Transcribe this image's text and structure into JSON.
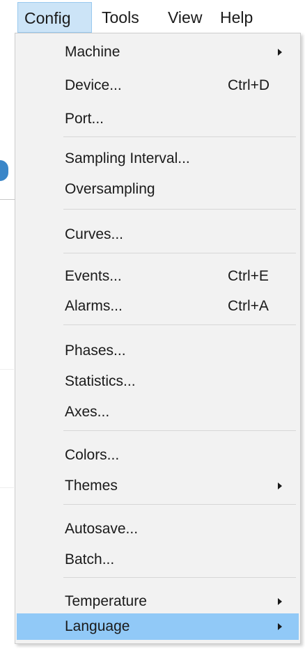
{
  "menubar": {
    "items": [
      {
        "label": "Config",
        "active": true
      },
      {
        "label": "Tools",
        "active": false
      },
      {
        "label": "View",
        "active": false
      },
      {
        "label": "Help",
        "active": false
      }
    ]
  },
  "menu": {
    "items": [
      {
        "label": "Machine",
        "shortcut": "",
        "submenu": true
      },
      {
        "label": "Device...",
        "shortcut": "Ctrl+D",
        "submenu": false
      },
      {
        "label": "Port...",
        "shortcut": "",
        "submenu": false
      },
      {
        "label": "Sampling Interval...",
        "shortcut": "",
        "submenu": false
      },
      {
        "label": "Oversampling",
        "shortcut": "",
        "submenu": false
      },
      {
        "label": "Curves...",
        "shortcut": "",
        "submenu": false
      },
      {
        "label": "Events...",
        "shortcut": "Ctrl+E",
        "submenu": false
      },
      {
        "label": "Alarms...",
        "shortcut": "Ctrl+A",
        "submenu": false
      },
      {
        "label": "Phases...",
        "shortcut": "",
        "submenu": false
      },
      {
        "label": "Statistics...",
        "shortcut": "",
        "submenu": false
      },
      {
        "label": "Axes...",
        "shortcut": "",
        "submenu": false
      },
      {
        "label": "Colors...",
        "shortcut": "",
        "submenu": false
      },
      {
        "label": "Themes",
        "shortcut": "",
        "submenu": true
      },
      {
        "label": "Autosave...",
        "shortcut": "",
        "submenu": false
      },
      {
        "label": "Batch...",
        "shortcut": "",
        "submenu": false
      },
      {
        "label": "Temperature",
        "shortcut": "",
        "submenu": true
      },
      {
        "label": "Language",
        "shortcut": "",
        "submenu": true,
        "highlighted": true
      }
    ]
  },
  "colors": {
    "menu_background": "#f2f2f2",
    "highlight": "#91c9f7",
    "menubar_active": "#cce4f7"
  }
}
